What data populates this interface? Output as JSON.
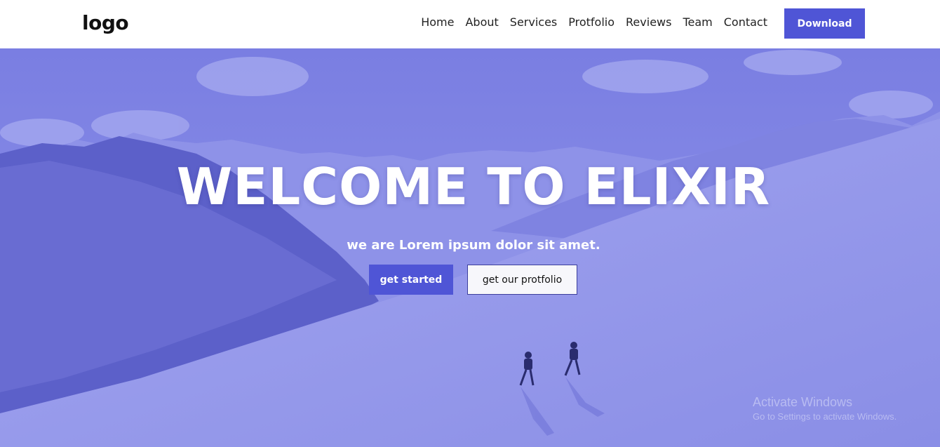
{
  "navbar": {
    "logo": "logo",
    "links": [
      "Home",
      "About",
      "Services",
      "Protfolio",
      "Reviews",
      "Team",
      "Contact"
    ],
    "download_label": "Download"
  },
  "hero": {
    "title": "WELCOME TO ELIXIR",
    "subtitle": "we are Lorem ipsum dolor sit amet.",
    "primary_button": "get started",
    "secondary_button": "get our protfolio"
  },
  "watermark": {
    "title": "Activate Windows",
    "subtitle": "Go to Settings to activate Windows."
  },
  "colors": {
    "accent": "#4f55d6",
    "overlay": "#7276df",
    "nav_bg": "#ffffff"
  }
}
